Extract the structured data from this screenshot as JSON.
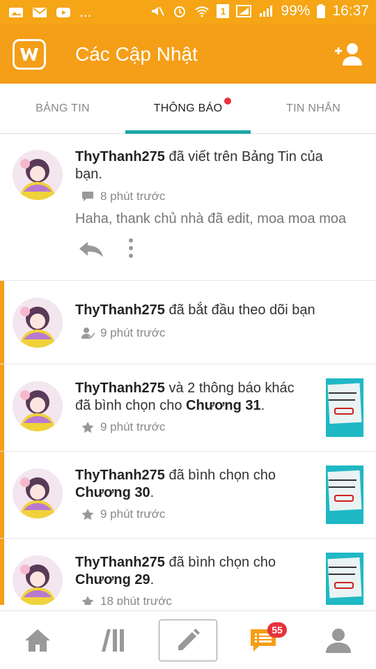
{
  "status_bar": {
    "ellipsis": "...",
    "sim": "1",
    "battery": "99%",
    "time": "16:37",
    "left_icons": [
      "photo-icon",
      "mail-icon",
      "youtube-icon"
    ],
    "right_icons": [
      "mute-icon",
      "alarm-icon",
      "wifi-icon",
      "sim-icon",
      "signal-icon",
      "signal-icon",
      "battery-icon"
    ]
  },
  "app_bar": {
    "title": "Các Cập Nhật",
    "logo": "wattpad-logo",
    "action_icon": "add-user-icon"
  },
  "tabs": [
    {
      "label": "BẢNG TIN",
      "active": false
    },
    {
      "label": "THÔNG BÁO",
      "active": true,
      "has_dot": true
    },
    {
      "label": "TIN NHẮN",
      "active": false
    }
  ],
  "notifications": [
    {
      "user": "ThyThanh275",
      "text": " đã viết trên Bảng Tin của bạn.",
      "time": "8 phút trước",
      "icon": "comment-icon",
      "quote": "Haha, thank chủ nhà đã edit, moa moa moa",
      "actions": [
        "reply-icon",
        "more-icon"
      ],
      "unread": false
    },
    {
      "user": "ThyThanh275",
      "text": " đã bắt đầu theo dõi bạn",
      "time": "9 phút trước",
      "icon": "follow-icon",
      "unread": true
    },
    {
      "user": "ThyThanh275",
      "text_a": " và 2 thông báo khác đã bình chọn cho ",
      "target": "Chương 31",
      "text_b": ".",
      "time": "9 phút trước",
      "icon": "star-icon",
      "unread": true
    },
    {
      "user": "ThyThanh275",
      "text_a": " đã bình chọn cho ",
      "target": "Chương 30",
      "text_b": ".",
      "time": "9 phút trước",
      "icon": "star-icon",
      "unread": true
    },
    {
      "user": "ThyThanh275",
      "text_a": " đã bình chọn cho ",
      "target": "Chương 29",
      "text_b": ".",
      "time": "18 phút trước",
      "icon": "star-icon",
      "unread": true
    }
  ],
  "bottom_nav": {
    "items": [
      "home-icon",
      "library-icon",
      "write-icon",
      "notifications-icon",
      "profile-icon"
    ],
    "badge": "55"
  },
  "colors": {
    "accent": "#f59e17",
    "tab_indicator": "#1aa6a6",
    "badge": "#e8323c"
  }
}
